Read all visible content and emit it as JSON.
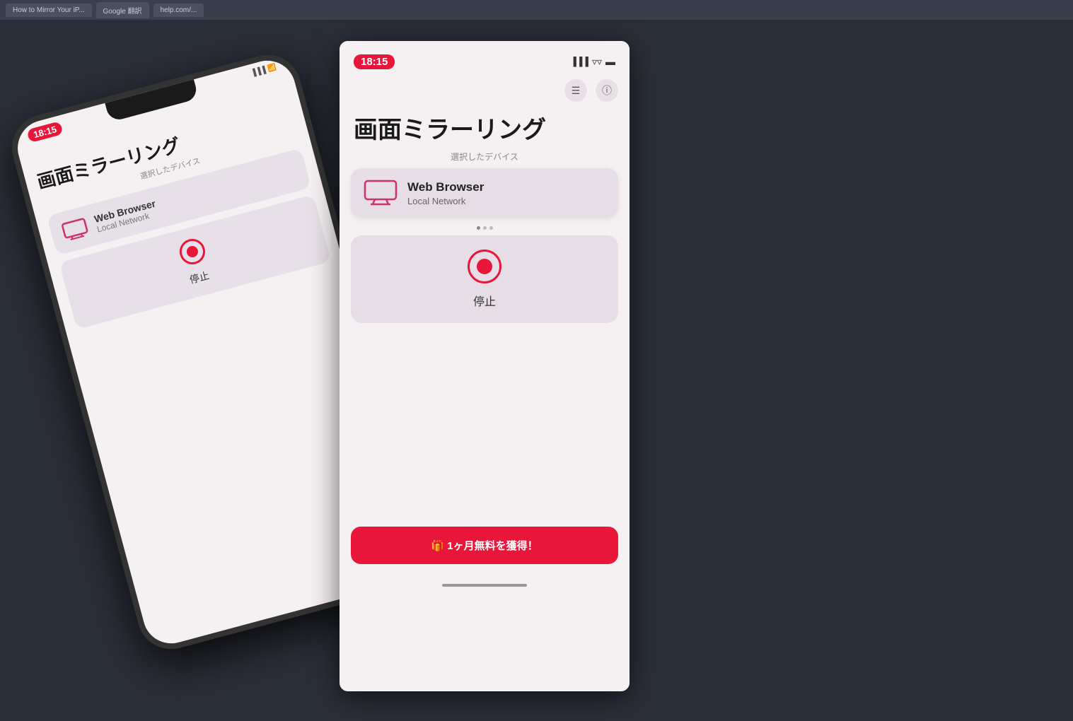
{
  "browser": {
    "tabs": [
      {
        "label": "How to Mirror Your iP..."
      },
      {
        "label": "Google 翻訳"
      },
      {
        "label": "help.com/..."
      }
    ]
  },
  "iphone": {
    "time": "18:15",
    "app_title": "画面ミラーリング",
    "section_label": "選択したデバイス",
    "device_name": "Web Browser",
    "device_sub": "Local Network",
    "stop_label": "停止"
  },
  "app": {
    "time": "18:15",
    "main_title": "画面ミラーリング",
    "section_label": "選択したデバイス",
    "device_name": "Web Browser",
    "device_sub": "Local Network",
    "stop_label": "停止",
    "promo_text": "🎁 1ヶ月無料を獲得！",
    "toolbar_filter": "≡",
    "toolbar_info": "ⓘ"
  }
}
